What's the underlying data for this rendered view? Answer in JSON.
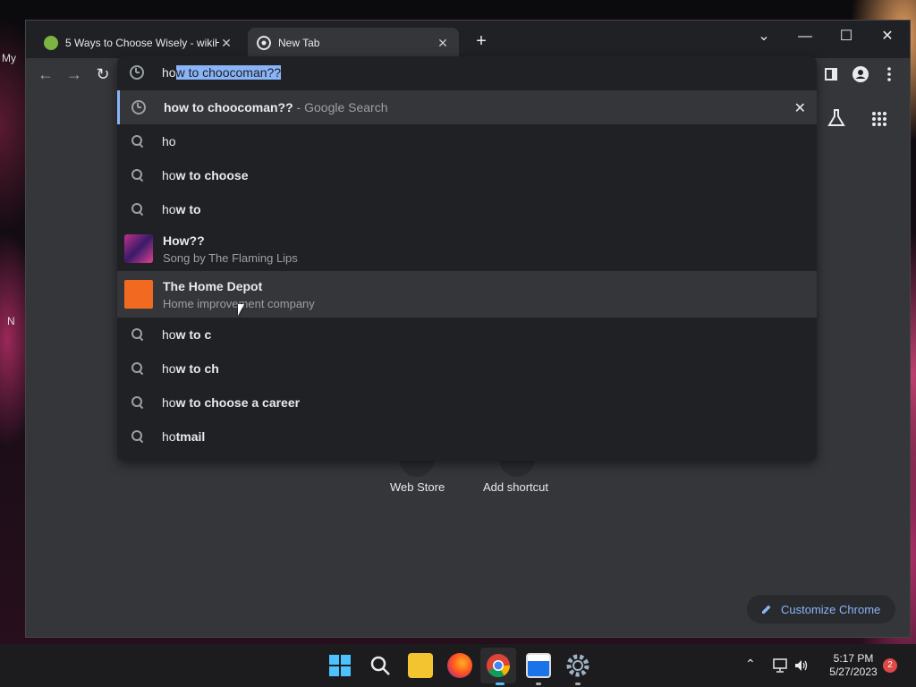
{
  "desktop": {
    "left_labels": [
      "My",
      "N"
    ]
  },
  "browser": {
    "tabs": [
      {
        "title": "5 Ways to Choose Wisely - wikiH",
        "close": "✕"
      },
      {
        "title": "New Tab",
        "close": "✕"
      }
    ],
    "new_tab": "+",
    "window_controls": {
      "dropdown": "⌄",
      "minimize": "—",
      "maximize": "☐",
      "close": "✕"
    }
  },
  "omnibox": {
    "typed_prefix": "ho",
    "autocomplete": "w to choocoman??",
    "suggestions": [
      {
        "type": "history",
        "bold_prefix": "ho",
        "bold": "w to choocoman??",
        "suffix": " - Google Search"
      },
      {
        "type": "search",
        "plain": "ho",
        "bold": ""
      },
      {
        "type": "search",
        "plain": "ho",
        "bold": "w to choose"
      },
      {
        "type": "search",
        "plain": "ho",
        "bold": "w to"
      },
      {
        "type": "entity",
        "title_plain": "How??",
        "subtitle": "Song by The Flaming Lips"
      },
      {
        "type": "entity",
        "title_a": "The Ho",
        "title_b": "me Depot",
        "subtitle": "Home improvement company"
      },
      {
        "type": "search",
        "plain": "ho",
        "bold": "w to c"
      },
      {
        "type": "search",
        "plain": "ho",
        "bold": "w to ch"
      },
      {
        "type": "search",
        "plain": "ho",
        "bold": "w to choose a career"
      },
      {
        "type": "search",
        "plain": "ho",
        "bold": "tmail"
      }
    ],
    "remove": "✕"
  },
  "ntp": {
    "shortcuts": [
      "Web Store",
      "Add shortcut"
    ],
    "customize": "Customize Chrome"
  },
  "taskbar": {
    "time": "5:17 PM",
    "date": "5/27/2023",
    "notifications": "2"
  }
}
